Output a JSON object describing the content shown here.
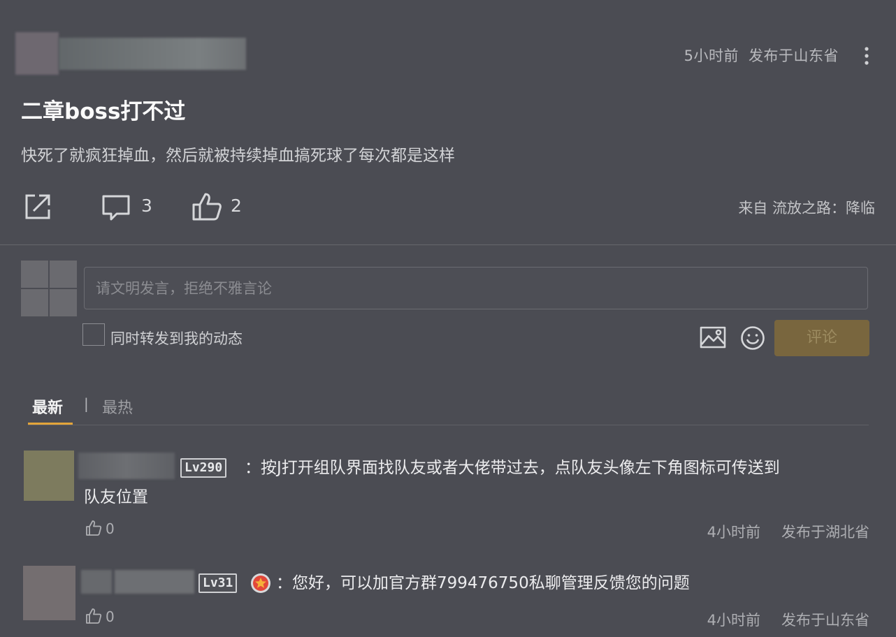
{
  "post": {
    "time": "5小时前",
    "location": "发布于山东省",
    "title": "二章boss打不过",
    "body": "快死了就疯狂掉血，然后就被持续掉血搞死球了每次都是这样",
    "comment_count": "3",
    "like_count": "2",
    "source": "来自 流放之路：降临"
  },
  "composer": {
    "placeholder": "请文明发言，拒绝不雅言论",
    "repost_label": "同时转发到我的动态",
    "submit_label": "评论"
  },
  "sort_tabs": {
    "latest": "最新",
    "separator": "|",
    "hot": "最热"
  },
  "comments": [
    {
      "level": "Lv290",
      "text_line1": "：按J打开组队界面找队友或者大佬带过去，点队友头像左下角图标可传送到",
      "text_line2": "队友位置",
      "likes": "0",
      "time": "4小时前",
      "location": "发布于湖北省"
    },
    {
      "level": "Lv31",
      "text_line1": "：您好，可以加官方群799476750私聊管理反馈您的问题",
      "likes": "0",
      "time": "4小时前",
      "location": "发布于山东省"
    }
  ],
  "colors": {
    "background": "#4b4c53",
    "accent": "#e3a53a",
    "submit_button": "#79663e"
  },
  "icons": [
    "more-vertical-icon",
    "share-icon",
    "comment-icon",
    "thumbs-up-icon",
    "image-icon",
    "emoji-icon",
    "medal-icon"
  ]
}
